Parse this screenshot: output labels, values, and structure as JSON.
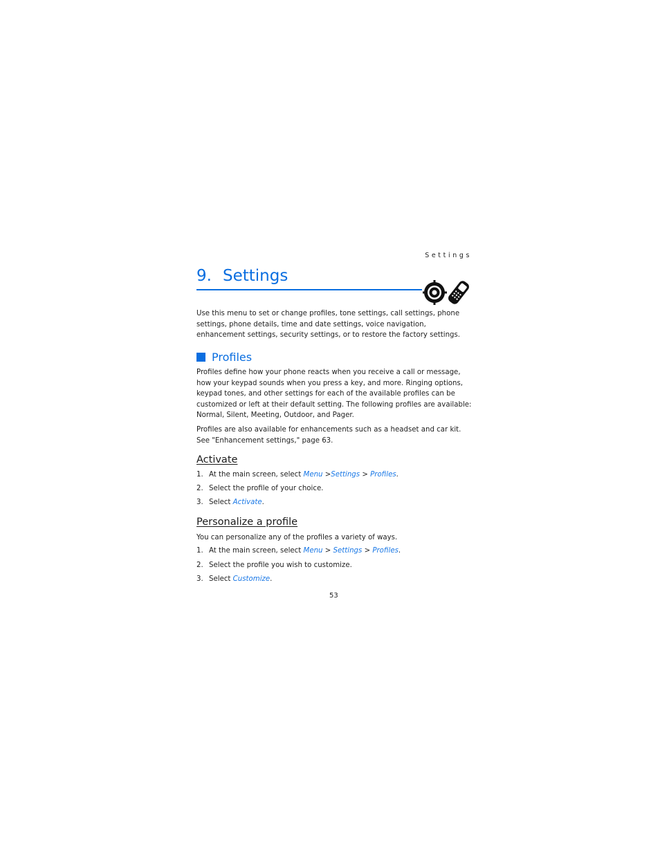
{
  "running_header": "Settings",
  "chapter": {
    "number": "9.",
    "title": "Settings",
    "icon": "settings-gear-phone-icon"
  },
  "intro": "Use this menu to set or change profiles, tone settings, call settings, phone settings, phone details, time and date settings, voice navigation, enhancement settings, security settings, or to restore the factory settings.",
  "profiles": {
    "heading": "Profiles",
    "para1": "Profiles define how your phone reacts when you receive a call or message, how your keypad sounds when you press a key, and more. Ringing options, keypad tones, and other settings for each of the available profiles can be customized or left at their default setting. The following profiles are available: Normal, Silent, Meeting, Outdoor, and Pager.",
    "para2_line1": "Profiles are also available for enhancements such as a headset and car kit.",
    "para2_line2": "See \"Enhancement settings,\" page 63."
  },
  "activate": {
    "heading": "Activate",
    "steps": [
      {
        "num": "1.",
        "text": "At the main screen, select ",
        "link1": "Menu",
        "sep1": " >",
        "link2": "Settings",
        "sep2": " > ",
        "link3": "Profiles",
        "end": "."
      },
      {
        "num": "2.",
        "text": "Select the profile of your choice."
      },
      {
        "num": "3.",
        "text": "Select ",
        "link1": "Activate",
        "end": "."
      }
    ]
  },
  "personalize": {
    "heading": "Personalize a profile",
    "intro": "You can personalize any of the profiles a variety of ways.",
    "steps": [
      {
        "num": "1.",
        "text": "At the main screen, select ",
        "link1": "Menu",
        "sep1": " > ",
        "link2": "Settings",
        "sep2": " > ",
        "link3": "Profiles",
        "end": "."
      },
      {
        "num": "2.",
        "text": "Select the profile you wish to customize."
      },
      {
        "num": "3.",
        "text": "Select ",
        "link1": "Customize",
        "end": "."
      }
    ]
  },
  "page_number": "53"
}
